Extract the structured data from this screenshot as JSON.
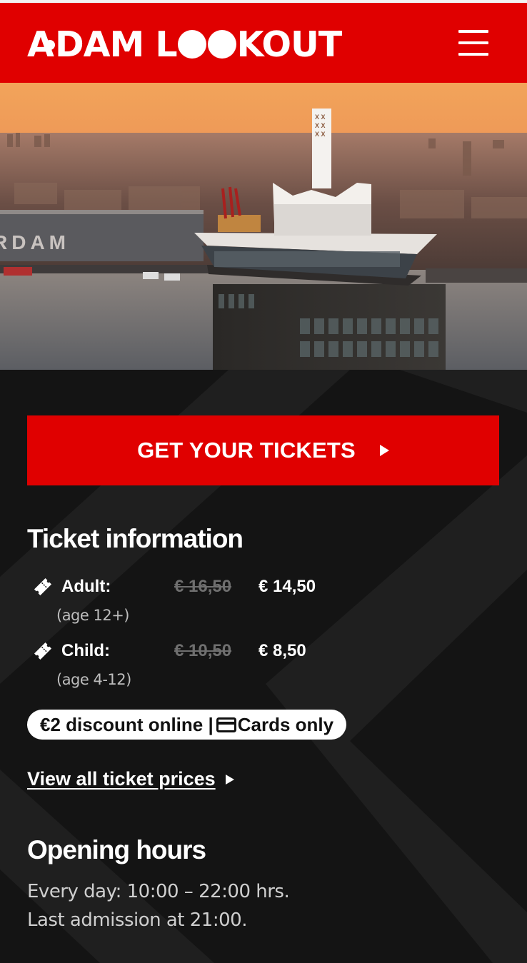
{
  "header": {
    "logo_parts": [
      "A",
      "DAM L",
      "KOUT"
    ],
    "logo_alt": "A'DAM LOOKOUT",
    "menu_icon": "hamburger-menu-icon"
  },
  "hero": {
    "image_text": "RDAM"
  },
  "cta": {
    "label": "GET YOUR TICKETS"
  },
  "tickets": {
    "title": "Ticket information",
    "rows": [
      {
        "label": "Adult:",
        "old_price": "€ 16,50",
        "price": "€ 14,50",
        "age": "(age 12+)"
      },
      {
        "label": "Child:",
        "old_price": "€ 10,50",
        "price": "€ 8,50",
        "age": "(age 4-12)"
      }
    ],
    "discount_text": "€2 discount online |",
    "cards_text": "Cards only",
    "view_all": "View all ticket prices"
  },
  "hours": {
    "title": "Opening hours",
    "line1": "Every day: 10:00 – 22:00 hrs.",
    "line2": "Last admission at 21:00."
  },
  "colors": {
    "brand_red": "#e00000",
    "background": "#141414"
  }
}
